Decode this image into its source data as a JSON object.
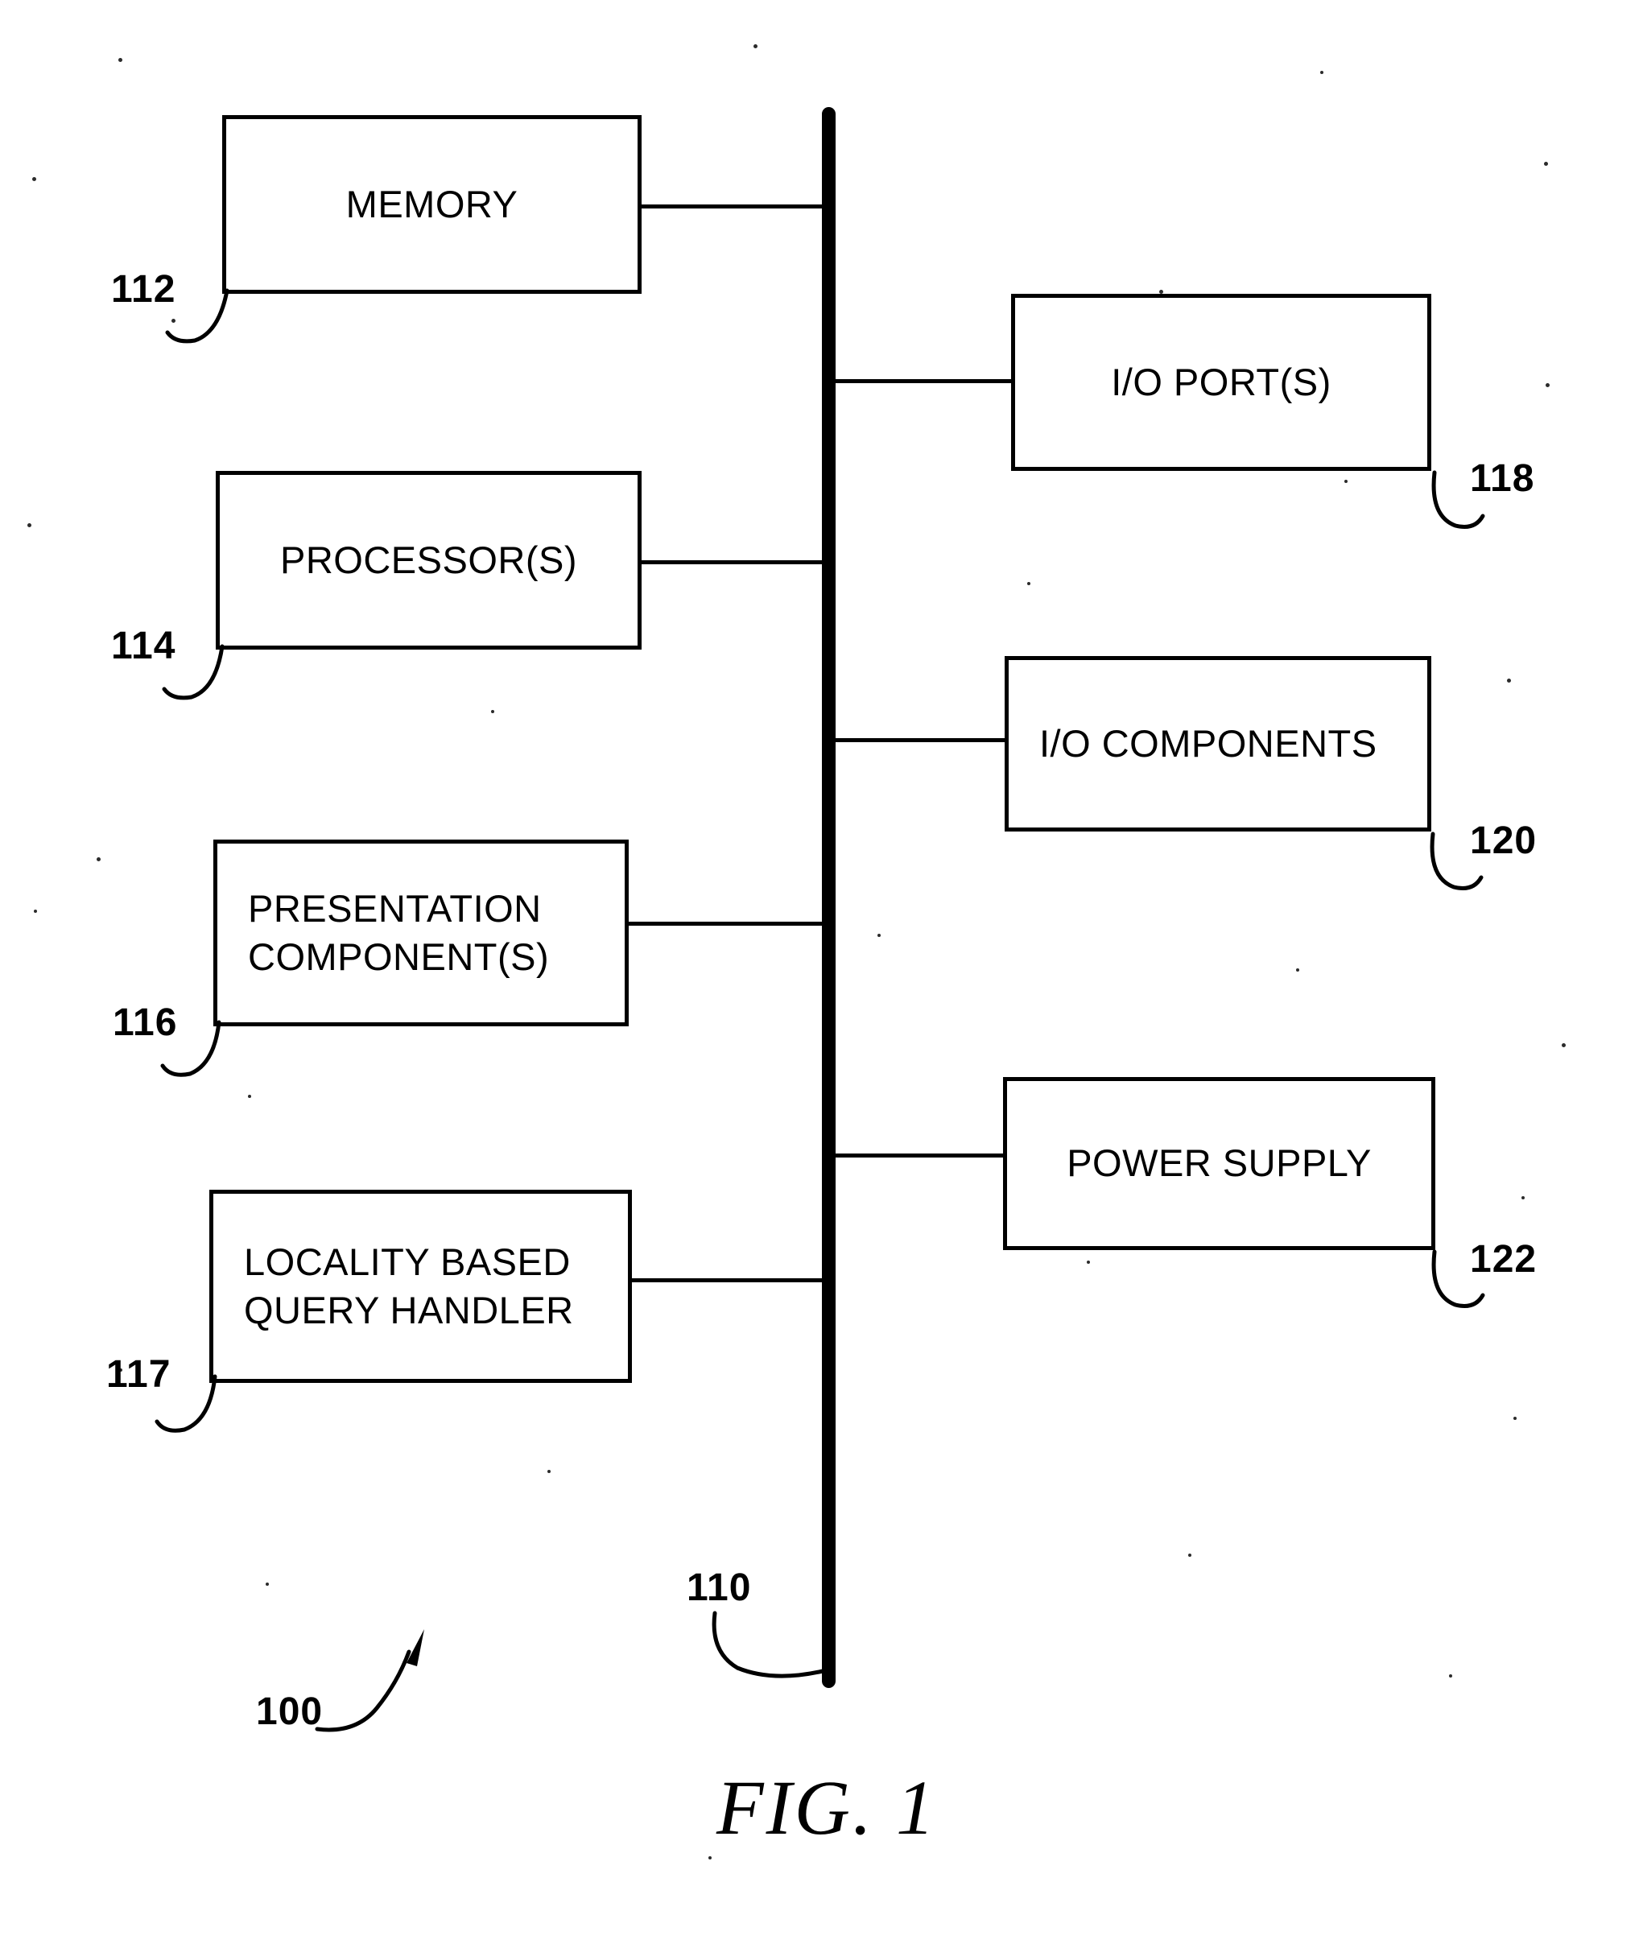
{
  "figure": {
    "caption": "FIG.  1",
    "system_ref": "100",
    "bus_ref": "110"
  },
  "left_blocks": [
    {
      "label": "MEMORY",
      "ref": "112",
      "align": "center"
    },
    {
      "label": "PROCESSOR(S)",
      "ref": "114",
      "align": "center"
    },
    {
      "label": "PRESENTATION\nCOMPONENT(S)",
      "ref": "116",
      "align": "left"
    },
    {
      "label": "LOCALITY BASED\nQUERY HANDLER",
      "ref": "117",
      "align": "left"
    }
  ],
  "right_blocks": [
    {
      "label": "I/O PORT(S)",
      "ref": "118",
      "align": "center"
    },
    {
      "label": "I/O COMPONENTS",
      "ref": "120",
      "align": "left"
    },
    {
      "label": "POWER SUPPLY",
      "ref": "122",
      "align": "center"
    }
  ],
  "colors": {
    "ink": "#000000",
    "paper": "#ffffff"
  }
}
